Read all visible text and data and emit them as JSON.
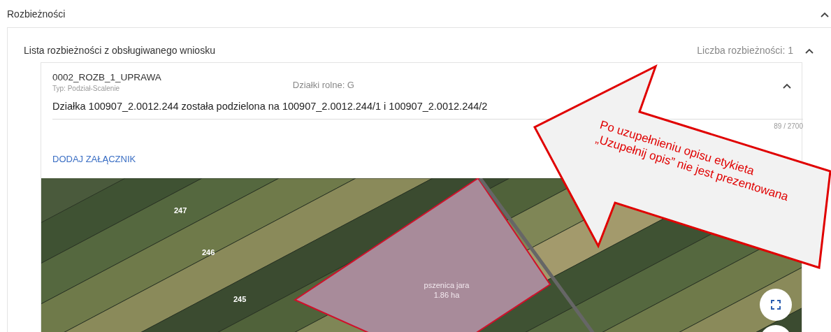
{
  "section": {
    "title": "Rozbieżności",
    "expanded": true
  },
  "panel": {
    "title": "Lista rozbieżności z obsługiwanego wniosku",
    "count": "Liczba rozbieżności: 1",
    "expanded": true
  },
  "item": {
    "code": "0002_ROZB_1_UPRAWA",
    "type": "Typ: Podział-Scalenie",
    "plots": "Działki rolne: G",
    "expanded": true,
    "description": "Działka 100907_2.0012.244 została podzielona na 100907_2.0012.244/1 i 100907_2.0012.244/2",
    "counter": "89 / 2700",
    "attach_button": "DODAJ ZAŁĄCZNIK"
  },
  "map": {
    "parcel_labels": [
      "247",
      "246",
      "245"
    ],
    "crop_name": "pszenica jara",
    "crop_area": "1.86 ha"
  },
  "callout": {
    "text": "Po uzupełnieniu opisu etykieta „Uzupełnij opis” nie jest prezentowana"
  }
}
